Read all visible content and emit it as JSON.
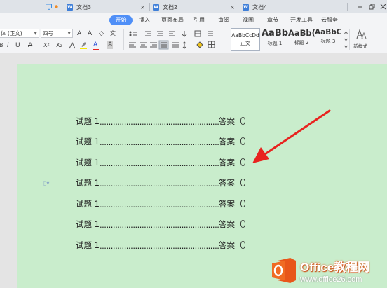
{
  "tabs": [
    {
      "label": "文档3",
      "close": "×"
    },
    {
      "label": "文档2",
      "close": "×"
    },
    {
      "label": "文档4",
      "close": ""
    }
  ],
  "menu": {
    "active": "开始",
    "items": [
      "插入",
      "页面布局",
      "引用",
      "审阅",
      "视图",
      "章节",
      "开发工具",
      "云服务"
    ]
  },
  "ribbon": {
    "font_name": "体 (正文)",
    "font_size": "四号",
    "btn_grow": "A⁺",
    "btn_shrink": "A⁻",
    "btn_clear": "◇",
    "btn_pinyin": "文",
    "btn_bold": "B",
    "btn_italic": "I",
    "btn_underline": "U",
    "btn_strike": "A",
    "btn_super": "X²",
    "btn_sub": "X₂",
    "btn_fontcolor": "A",
    "btn_charshade": "A",
    "styles": [
      {
        "sample": "AaBbCcDd",
        "name": "正文"
      },
      {
        "sample": "AaBb",
        "name": "标题 1"
      },
      {
        "sample": "AaBb(",
        "name": "标题 2"
      },
      {
        "sample": "AaBbC",
        "name": "标题 3"
      }
    ],
    "new_style_label": "新样式·"
  },
  "document": {
    "rows": [
      {
        "prefix": "试题 1",
        "dots": "......................................................",
        "suffix": "答案（）"
      },
      {
        "prefix": "试题 1",
        "dots": "......................................................",
        "suffix": "答案（）"
      },
      {
        "prefix": "试题 1",
        "dots": "......................................................",
        "suffix": "答案（）"
      },
      {
        "prefix": "试题 1",
        "dots": "......................................................",
        "suffix": "答案（）"
      },
      {
        "prefix": "试题 1",
        "dots": "......................................................",
        "suffix": "答案（）"
      },
      {
        "prefix": "试题 1",
        "dots": "......................................................",
        "suffix": "答案（）"
      },
      {
        "prefix": "试题 1",
        "dots": "......................................................",
        "suffix": "答案（）"
      }
    ],
    "background_color": "#c9edcc",
    "arrow_color": "#e8231f"
  },
  "watermark": {
    "title": "Office教程网",
    "url": "www.office26.com",
    "logo_color": "#e8561a"
  }
}
